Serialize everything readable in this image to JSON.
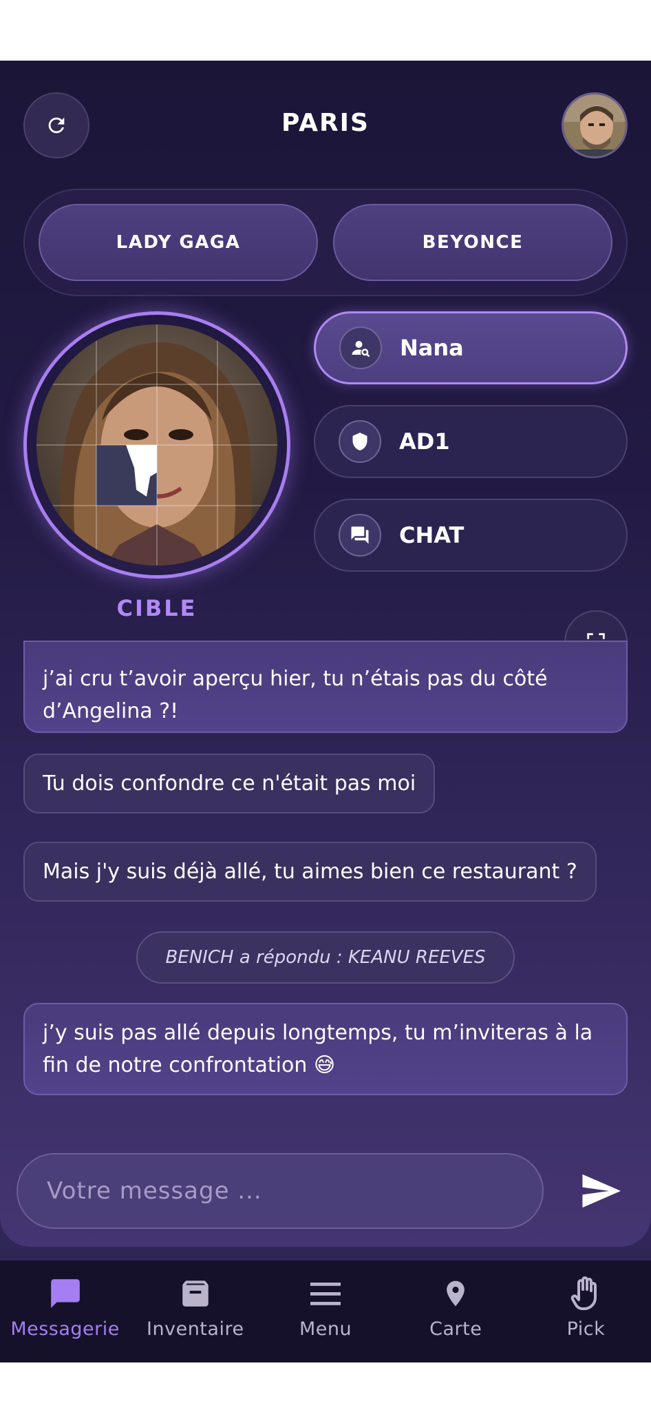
{
  "header": {
    "title": "PARIS"
  },
  "teams": {
    "left": "LADY GAGA",
    "right": "BEYONCE"
  },
  "target": {
    "label": "CIBLE"
  },
  "options": [
    {
      "label": "Nana",
      "icon": "person-search-icon",
      "active": true
    },
    {
      "label": "AD1",
      "icon": "shield-icon",
      "active": false
    },
    {
      "label": "CHAT",
      "icon": "chat-icon",
      "active": false
    }
  ],
  "messages": [
    {
      "text": "j’ai cru t’avoir aperçu hier, tu n’étais pas du côté d’Angelina ?!",
      "from": "me"
    },
    {
      "text": "Tu dois confondre ce n'était pas moi",
      "from": "other"
    },
    {
      "text": "Mais j'y suis déjà allé, tu aimes bien ce restaurant ?",
      "from": "other"
    },
    {
      "text": "BENICH a répondu : KEANU REEVES",
      "from": "system"
    },
    {
      "text": "j’y suis pas allé depuis longtemps, tu m’inviteras à la fin de notre confrontation 😅",
      "from": "me"
    }
  ],
  "composer": {
    "placeholder": "Votre message ..."
  },
  "nav": [
    {
      "label": "Messagerie",
      "icon": "chat-bubble-icon",
      "active": true
    },
    {
      "label": "Inventaire",
      "icon": "archive-box-icon",
      "active": false
    },
    {
      "label": "Menu",
      "icon": "hamburger-menu-icon",
      "active": false
    },
    {
      "label": "Carte",
      "icon": "map-pin-icon",
      "active": false
    },
    {
      "label": "Pick",
      "icon": "hand-icon",
      "active": false
    }
  ],
  "colors": {
    "accent": "#a87ef0",
    "background": "#1b1638",
    "nav_background": "#15112b"
  }
}
